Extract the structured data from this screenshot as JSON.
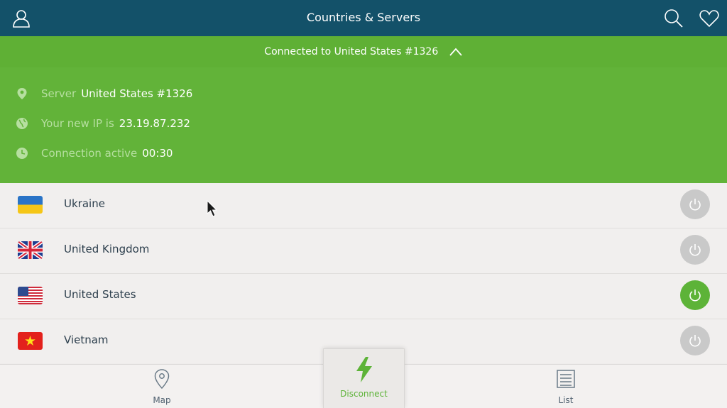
{
  "header": {
    "title": "Countries & Servers",
    "icons": [
      "user-icon",
      "search-icon",
      "heart-icon"
    ]
  },
  "connection": {
    "status_text": "Connected to United States #1326",
    "server_label": "Server",
    "server_value": "United States #1326",
    "ip_label": "Your new IP is",
    "ip_value": "23.19.87.232",
    "time_label": "Connection active",
    "time_value": "00:30"
  },
  "countries": [
    {
      "name": "Ukraine",
      "flag": "ukraine-flag-icon",
      "connected": false
    },
    {
      "name": "United Kingdom",
      "flag": "uk-flag-icon",
      "connected": false
    },
    {
      "name": "United States",
      "flag": "us-flag-icon",
      "connected": true
    },
    {
      "name": "Vietnam",
      "flag": "vietnam-flag-icon",
      "connected": false
    }
  ],
  "bottom_nav": {
    "map_label": "Map",
    "disconnect_label": "Disconnect",
    "list_label": "List"
  },
  "colors": {
    "header_bg": "#135169",
    "connected_green": "#5fb035",
    "power_inactive": "#c9c9c9",
    "power_active": "#5db338"
  }
}
